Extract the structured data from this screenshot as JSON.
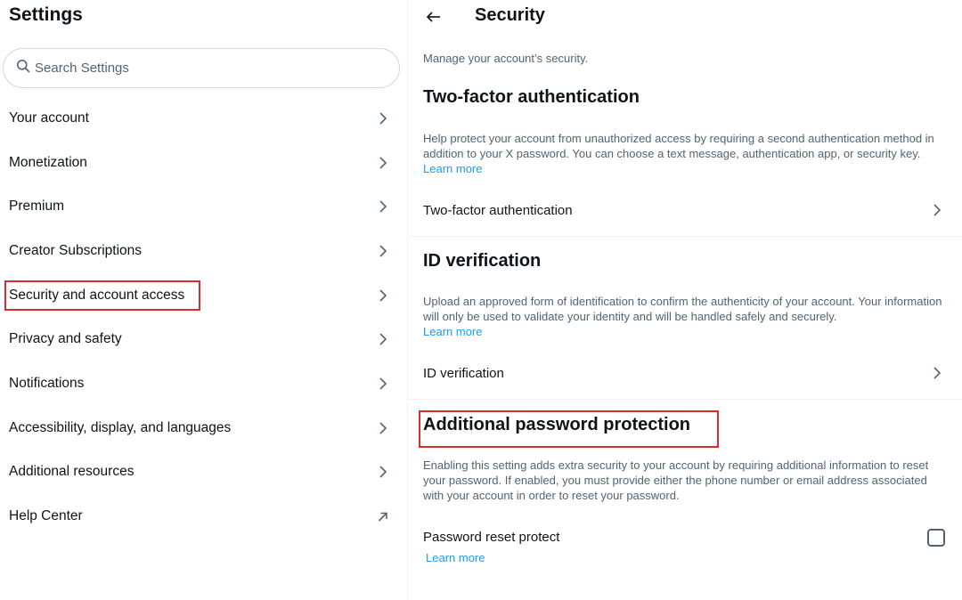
{
  "left": {
    "title": "Settings",
    "search": {
      "placeholder": "Search Settings",
      "value": ""
    },
    "items": [
      {
        "label": "Your account",
        "icon": "chevron-right-icon"
      },
      {
        "label": "Monetization",
        "icon": "chevron-right-icon"
      },
      {
        "label": "Premium",
        "icon": "chevron-right-icon"
      },
      {
        "label": "Creator Subscriptions",
        "icon": "chevron-right-icon"
      },
      {
        "label": "Security and account access",
        "icon": "chevron-right-icon",
        "highlighted": true
      },
      {
        "label": "Privacy and safety",
        "icon": "chevron-right-icon"
      },
      {
        "label": "Notifications",
        "icon": "chevron-right-icon"
      },
      {
        "label": "Accessibility, display, and languages",
        "icon": "chevron-right-icon"
      },
      {
        "label": "Additional resources",
        "icon": "chevron-right-icon"
      },
      {
        "label": "Help Center",
        "icon": "external-link-arrow-icon"
      }
    ]
  },
  "right": {
    "title": "Security",
    "back_icon": "arrow-left-icon",
    "subtitle": "Manage your account’s security.",
    "sections": [
      {
        "title": "Two-factor authentication",
        "description": "Help protect your account from unauthorized access by requiring a second authentication method in addition to your X password. You can choose a text message, authentication app, or security key.",
        "link": "Learn more",
        "row_label": "Two-factor authentication"
      },
      {
        "title": "ID verification",
        "description": "Upload an approved form of identification to confirm the authenticity of your account. Your information will only be used to validate your identity and will be handled safely and securely.",
        "link": "Learn more",
        "row_label": "ID verification"
      },
      {
        "title": "Additional password protection",
        "description": "Enabling this setting adds extra security to your account by requiring additional information to reset your password. If enabled, you must provide either the phone number or email address associated with your account in order to reset your password.",
        "row_label": "Password reset protect",
        "row_link": "Learn more",
        "checked": false,
        "highlighted": true
      }
    ]
  },
  "colors": {
    "text": "#0f1419",
    "secondary": "#536471",
    "link": "#1d9bf0",
    "highlight": "#d32f2f"
  }
}
